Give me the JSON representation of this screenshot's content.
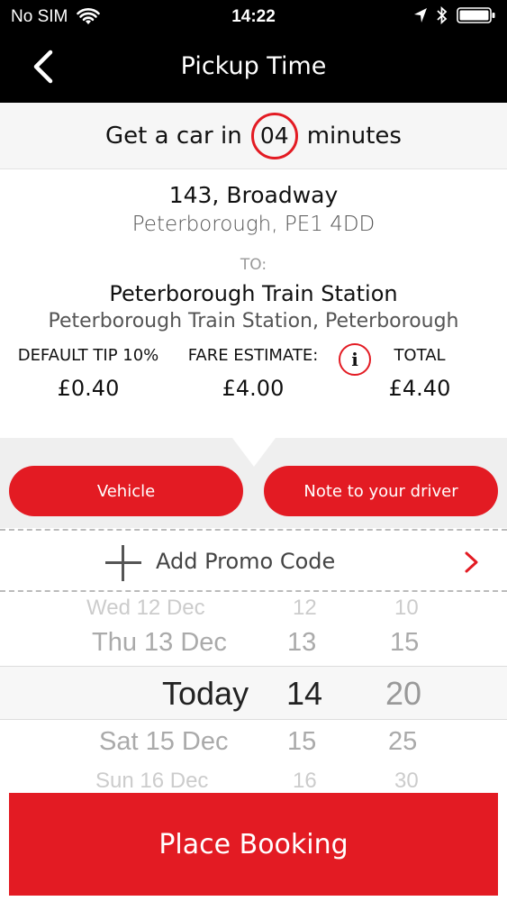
{
  "status_bar": {
    "carrier": "No SIM",
    "time": "14:22"
  },
  "nav": {
    "title": "Pickup Time"
  },
  "eta": {
    "prefix": "Get a car in",
    "minutes": "04",
    "suffix": "minutes"
  },
  "pickup": {
    "line1": "143,  Broadway",
    "line2": "Peterborough, PE1 4DD"
  },
  "to_label": "TO:",
  "dropoff": {
    "line1": "Peterborough Train Station",
    "line2": "Peterborough Train Station, Peterborough"
  },
  "fare": {
    "tip_label": "DEFAULT TIP 10%",
    "tip_value": "£0.40",
    "estimate_label": "FARE ESTIMATE:",
    "estimate_value": "£4.00",
    "total_label": "TOTAL",
    "total_value": "£4.40"
  },
  "buttons": {
    "vehicle": "Vehicle",
    "note": "Note to your driver",
    "place_booking": "Place Booking"
  },
  "promo": {
    "label": "Add Promo Code"
  },
  "picker": {
    "days": [
      "Wed 12 Dec",
      "Thu 13 Dec",
      "Today",
      "Sat 15 Dec",
      "Sun 16 Dec"
    ],
    "hours": [
      "12",
      "13",
      "14",
      "15",
      "16"
    ],
    "minutes": [
      "10",
      "15",
      "20",
      "25",
      "30"
    ]
  },
  "colors": {
    "accent": "#e31b23",
    "bar": "#000000"
  },
  "icons": {
    "wifi": "wifi-icon",
    "location": "location-arrow-icon",
    "bluetooth": "bluetooth-icon",
    "battery": "battery-icon",
    "back": "chevron-left-icon",
    "info": "info-icon",
    "plus": "plus-icon",
    "chevron": "chevron-right-icon"
  }
}
